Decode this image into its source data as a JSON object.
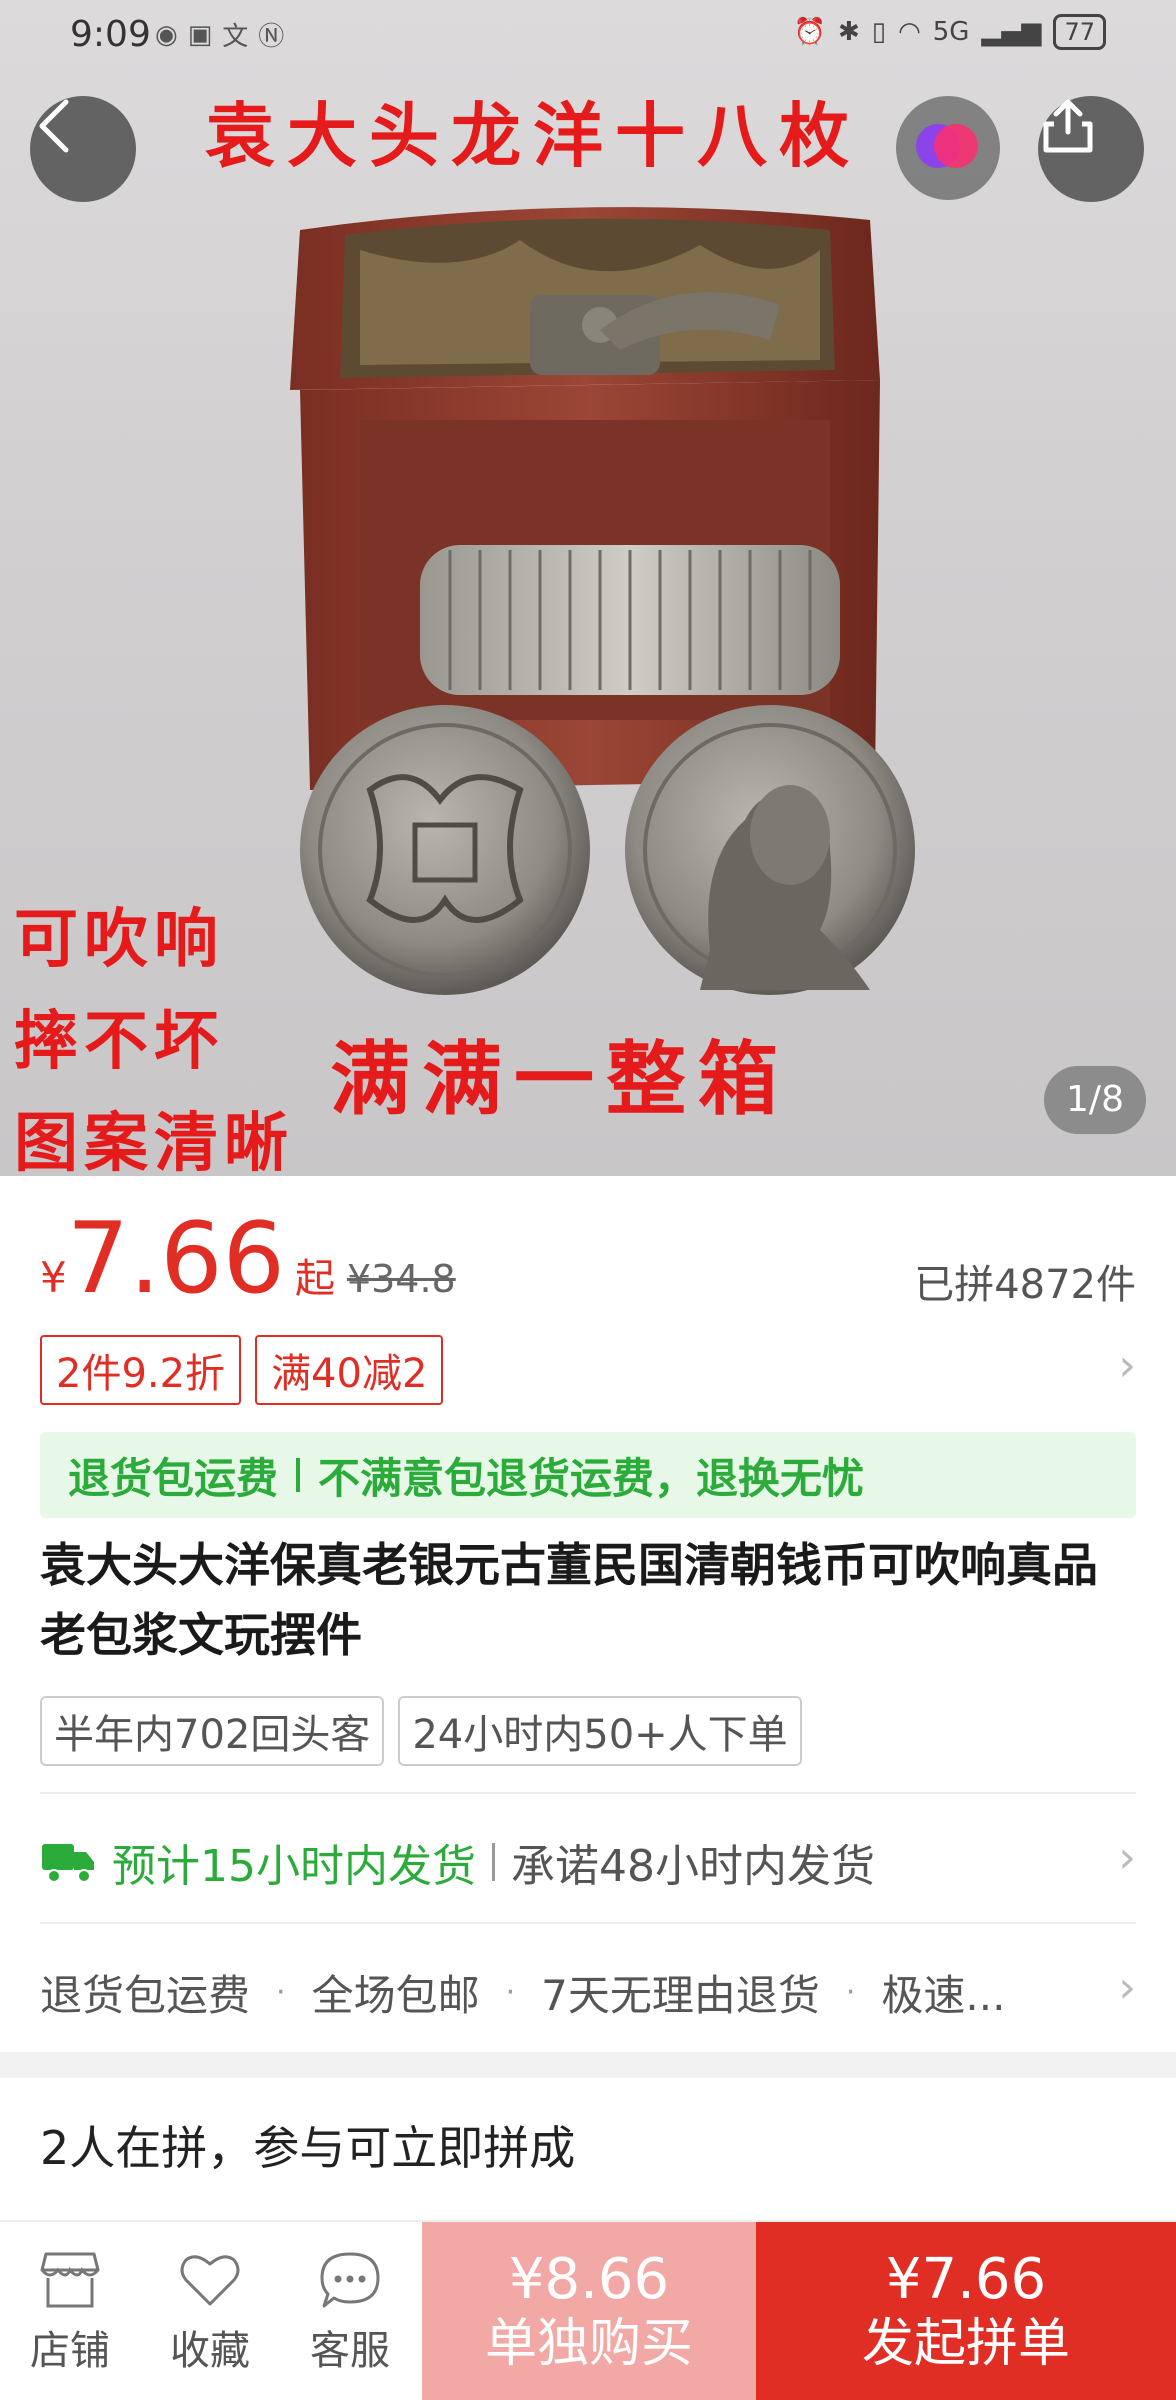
{
  "status_bar": {
    "time": "9:09",
    "battery": "77",
    "network": "5G"
  },
  "hero": {
    "banner_title": "袁大头龙洋十八枚",
    "side_lines": [
      "可吹响",
      "摔不坏",
      "图案清晰"
    ],
    "big_tag": "满满一整箱",
    "counter": "1/8"
  },
  "product": {
    "currency": "¥",
    "price": "7.66",
    "price_suffix": "起",
    "original_price": "¥34.8",
    "sold_count": "已拼4872件",
    "coupons": [
      "2件9.2折",
      "满40减2"
    ],
    "guarantee": [
      "退货包运费",
      "不满意包退货运费，退换无忧"
    ],
    "title": "袁大头大洋保真老银元古董民国清朝钱币可吹响真品老包浆文玩摆件",
    "tags": [
      "半年内702回头客",
      "24小时内50+人下单"
    ],
    "shipping_estimate": "预计15小时内发货",
    "shipping_promise": "承诺48小时内发货",
    "services": [
      "退货包运费",
      "全场包邮",
      "7天无理由退货",
      "极速..."
    ],
    "group_info": "2人在拼，参与可立即拼成"
  },
  "bottom_bar": {
    "store_label": "店铺",
    "favorite_label": "收藏",
    "service_label": "客服",
    "solo_price": "¥8.66",
    "solo_label": "单独购买",
    "group_price": "¥7.66",
    "group_label": "发起拼单"
  },
  "colors": {
    "accent": "#e02e24",
    "green": "#2bab3a",
    "solo_button": "#f2a8a5"
  }
}
